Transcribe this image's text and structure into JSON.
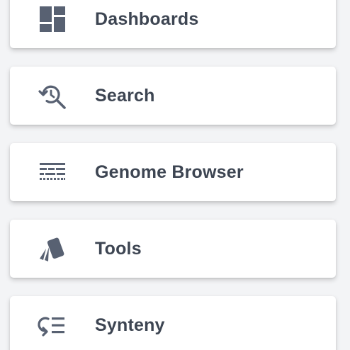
{
  "nav": {
    "items": [
      {
        "label": "Dashboards",
        "icon": "dashboard-grid-icon"
      },
      {
        "label": "Search",
        "icon": "search-history-icon"
      },
      {
        "label": "Genome Browser",
        "icon": "genome-track-icon"
      },
      {
        "label": "Tools",
        "icon": "tools-cards-icon"
      },
      {
        "label": "Synteny",
        "icon": "synteny-list-icon"
      }
    ]
  },
  "colors": {
    "text": "#3d4552",
    "icon": "#586172",
    "card_bg": "#ffffff",
    "page_bg": "#f3f4f6"
  }
}
